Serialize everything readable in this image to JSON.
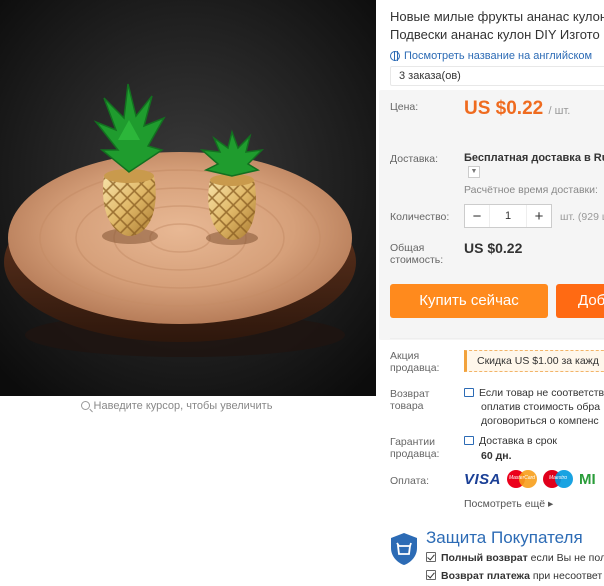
{
  "gallery": {
    "zoom_hint": "Наведите курсор, чтобы увеличить"
  },
  "product": {
    "title_line1": "Новые милые фрукты ананас кулон",
    "title_line2": "Подвески ананас кулон DIY Изгото",
    "translate_link": "Посмотреть название на английском",
    "orders": "3 заказа(ов)"
  },
  "price": {
    "label": "Цена:",
    "value": "US $0.22",
    "unit": "/ шт."
  },
  "shipping": {
    "label": "Доставка:",
    "method": "Бесплатная доставка в Rus",
    "estimate": "Расчётное время доставки:"
  },
  "quantity": {
    "label": "Количество:",
    "minus": "−",
    "value": "1",
    "plus": "+",
    "stock": "шт. (929 ш"
  },
  "total": {
    "label_line1": "Общая",
    "label_line2": "стоимость:",
    "value": "US $0.22"
  },
  "actions": {
    "buy_now": "Купить сейчас",
    "add_to_cart": "Доба"
  },
  "promo": {
    "label_line1": "Акция",
    "label_line2": "продавца:",
    "coupon": "Скидка US $1.00 за кажд"
  },
  "returns": {
    "label_line1": "Возврат",
    "label_line2": "товара",
    "line1": "Если товар не соответству",
    "line2": "оплатив стоимость обра",
    "line3": "договориться о компенс"
  },
  "guarantees": {
    "label_line1": "Гарантии",
    "label_line2": "продавца:",
    "line1": "Доставка в срок",
    "line2": "60 дн."
  },
  "payment": {
    "label": "Оплата:",
    "visa": "VISA",
    "maestro": "Maestro",
    "mastercard": "MasterCard",
    "more": "Посмотреть ещё ▸",
    "extra": "MI"
  },
  "protection": {
    "title": "Защита Покупателя",
    "line1_bold": "Полный возврат",
    "line1_rest": "если Вы не пол",
    "line2_bold": "Возврат платежа",
    "line2_rest": "при несоответ"
  },
  "colors": {
    "accent_orange": "#ff8a1d",
    "price_orange": "#ef6b1f",
    "link_blue": "#2c6bb5"
  }
}
